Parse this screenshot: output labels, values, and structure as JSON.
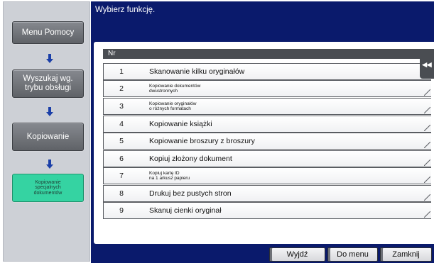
{
  "header": {
    "prompt": "Wybierz funkcję."
  },
  "sidebar": {
    "items": [
      {
        "label": "Menu Pomocy"
      },
      {
        "label": "Wyszukaj wg.\ntrybu obsługi"
      },
      {
        "label": "Kopiowanie"
      },
      {
        "label": "Kopiowanie\nspecjalnych\ndokumentów",
        "active": true
      }
    ]
  },
  "table": {
    "header": "Nr",
    "rows": [
      {
        "num": "1",
        "label": "Skanowanie kilku oryginałów"
      },
      {
        "num": "2",
        "label": "Kopiowanie dokumentów\ndwustronnych"
      },
      {
        "num": "3",
        "label": "Kopiowanie oryginałów\no różnych formatach"
      },
      {
        "num": "4",
        "label": "Kopiowanie książki"
      },
      {
        "num": "5",
        "label": "Kopiowanie broszury z broszury"
      },
      {
        "num": "6",
        "label": "Kopiuj złożony dokument"
      },
      {
        "num": "7",
        "label": "Kopiuj kartę ID\nna 1 arkusz papieru"
      },
      {
        "num": "8",
        "label": "Drukuj bez pustych stron"
      },
      {
        "num": "9",
        "label": "Skanuj cienki oryginał"
      }
    ]
  },
  "side_tab": {
    "icon": "back-arrows-icon",
    "glyph": "◂◂"
  },
  "buttons": {
    "exit": "Wyjdź",
    "menu": "Do menu",
    "close": "Zamknij"
  },
  "colors": {
    "banner": "#0a1a6c",
    "active": "#35d3a2",
    "arrow": "#1b3fa8"
  }
}
